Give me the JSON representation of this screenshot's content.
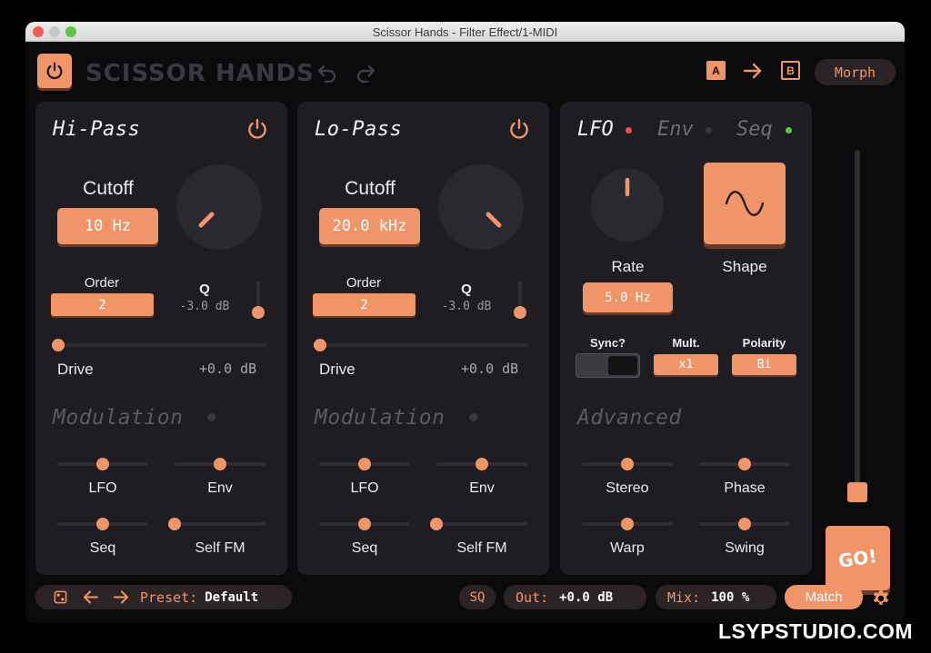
{
  "window": {
    "title": "Scissor Hands - Filter Effect/1-MIDI"
  },
  "header": {
    "brand": "SCISSOR HANDS",
    "ab_a": "A",
    "ab_b": "B",
    "morph_label": "Morph"
  },
  "hipass": {
    "title": "Hi-Pass",
    "cutoff_label": "Cutoff",
    "cutoff_value": "10 Hz",
    "order_label": "Order",
    "order_value": "2",
    "q_label": "Q",
    "q_value": "-3.0 dB",
    "drive_label": "Drive",
    "drive_value": "+0.0 dB",
    "modulation_title": "Modulation",
    "mod": [
      "LFO",
      "Env",
      "Seq",
      "Self FM"
    ]
  },
  "lopass": {
    "title": "Lo-Pass",
    "cutoff_label": "Cutoff",
    "cutoff_value": "20.0 kHz",
    "order_label": "Order",
    "order_value": "2",
    "q_label": "Q",
    "q_value": "-3.0 dB",
    "drive_label": "Drive",
    "drive_value": "+0.0 dB",
    "modulation_title": "Modulation",
    "mod": [
      "LFO",
      "Env",
      "Seq",
      "Self FM"
    ]
  },
  "lfo": {
    "tabs": [
      "LFO",
      "Env",
      "Seq"
    ],
    "tab_dot_colors": [
      "#e0574f",
      "#3a3840",
      "#5fc54a"
    ],
    "rate_label": "Rate",
    "rate_value": "5.0 Hz",
    "shape_label": "Shape",
    "sync_label": "Sync?",
    "mult_label": "Mult.",
    "mult_value": "x1",
    "polarity_label": "Polarity",
    "polarity_value": "Bi",
    "advanced_title": "Advanced",
    "adv": [
      "Stereo",
      "Phase",
      "Warp",
      "Swing"
    ]
  },
  "go_label": "GO!",
  "footer": {
    "preset_label": "Preset:",
    "preset_value": "Default",
    "sq_label": "SQ",
    "out_label": "Out:",
    "out_value": "+0.0 dB",
    "mix_label": "Mix:",
    "mix_value": "100 %",
    "match_label": "Match"
  },
  "watermark": "LSYPSTUDIO.COM",
  "colors": {
    "accent": "#f0956a",
    "panel": "#1f1d22",
    "background": "#0b0a0c"
  }
}
